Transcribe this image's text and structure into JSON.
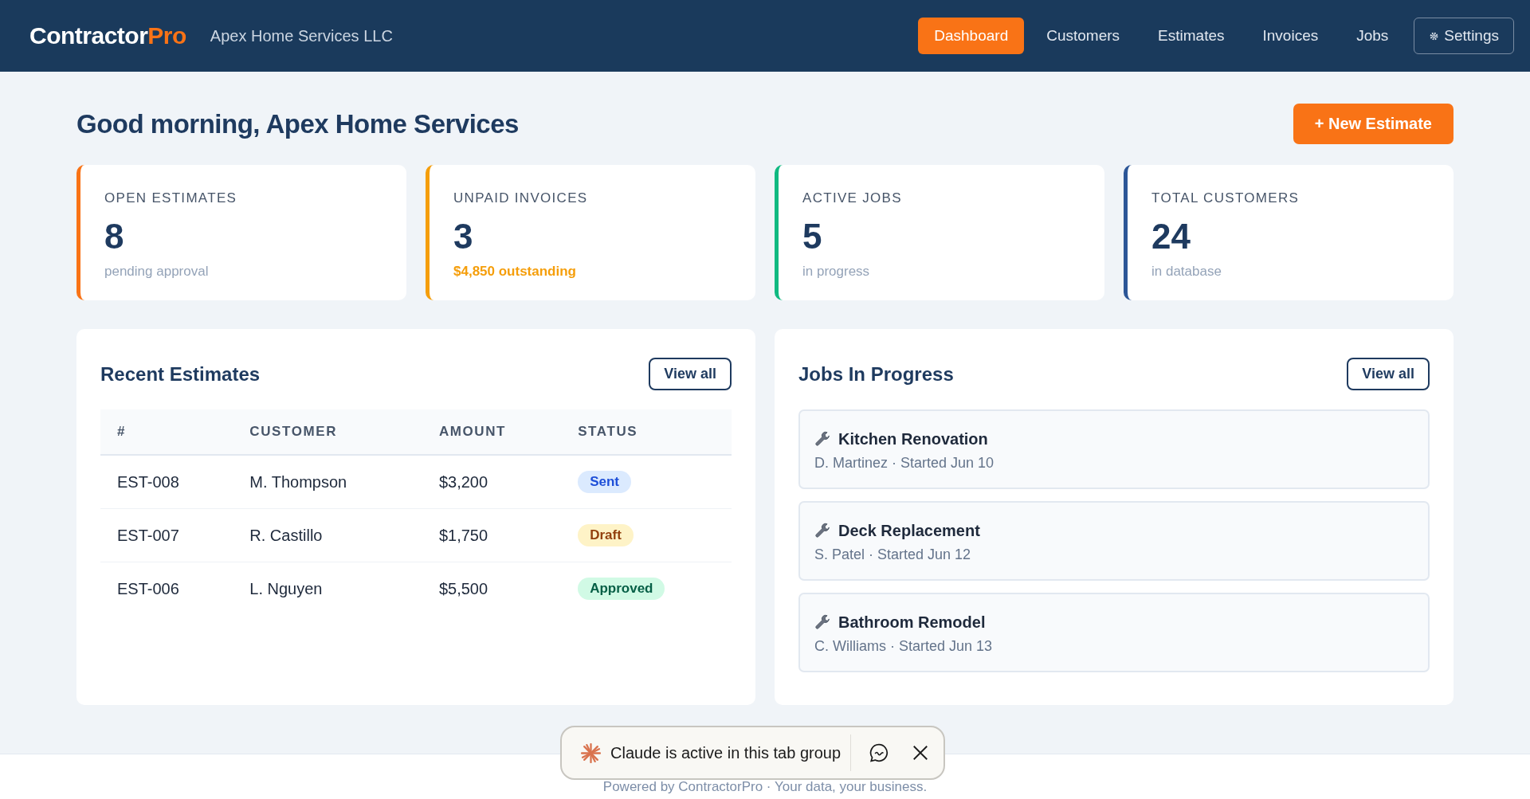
{
  "header": {
    "logo": {
      "text": "Contractor",
      "accent": "Pro"
    },
    "company": "Apex Home Services LLC",
    "nav": [
      {
        "label": "Dashboard",
        "selected": true
      },
      {
        "label": "Customers",
        "selected": false
      },
      {
        "label": "Estimates",
        "selected": false
      },
      {
        "label": "Invoices",
        "selected": false
      },
      {
        "label": "Jobs",
        "selected": false
      }
    ],
    "settings": "Settings"
  },
  "greeting": "Good morning, Apex Home Services",
  "new_button": "+ New Estimate",
  "stats": [
    {
      "label": "OPEN ESTIMATES",
      "value": "8",
      "sub": "pending approval",
      "color": "#f97316",
      "highlight": false
    },
    {
      "label": "UNPAID INVOICES",
      "value": "3",
      "sub": "$4,850 outstanding",
      "color": "#f59e0b",
      "highlight": true
    },
    {
      "label": "ACTIVE JOBS",
      "value": "5",
      "sub": "in progress",
      "color": "#10b981",
      "highlight": false
    },
    {
      "label": "TOTAL CUSTOMERS",
      "value": "24",
      "sub": "in database",
      "color": "#2c5697",
      "highlight": false
    }
  ],
  "estimates": {
    "title": "Recent Estimates",
    "view_all": "View all",
    "columns": [
      "#",
      "CUSTOMER",
      "AMOUNT",
      "STATUS"
    ],
    "rows": [
      {
        "id": "EST-008",
        "customer": "M. Thompson",
        "amount": "$3,200",
        "status": {
          "label": "Sent",
          "kind": "sent"
        }
      },
      {
        "id": "EST-007",
        "customer": "R. Castillo",
        "amount": "$1,750",
        "status": {
          "label": "Draft",
          "kind": "draft"
        }
      },
      {
        "id": "EST-006",
        "customer": "L. Nguyen",
        "amount": "$5,500",
        "status": {
          "label": "Approved",
          "kind": "approved"
        }
      }
    ]
  },
  "jobs": {
    "title": "Jobs In Progress",
    "view_all": "View all",
    "items": [
      {
        "name": "Kitchen Renovation",
        "detail": "D. Martinez · Started Jun 10"
      },
      {
        "name": "Deck Replacement",
        "detail": "S. Patel · Started Jun 12"
      },
      {
        "name": "Bathroom Remodel",
        "detail": "C. Williams · Started Jun 13"
      }
    ]
  },
  "footer": "Powered by ContractorPro · Your data, your business.",
  "toast": {
    "text": "Claude is active in this tab group"
  }
}
